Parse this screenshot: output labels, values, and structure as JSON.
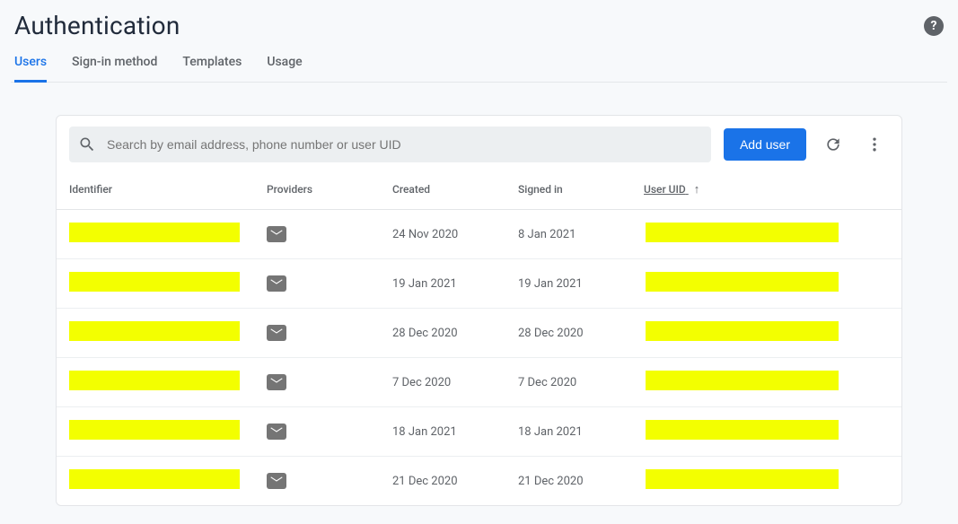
{
  "page": {
    "title": "Authentication"
  },
  "tabs": [
    {
      "label": "Users",
      "active": true
    },
    {
      "label": "Sign-in method",
      "active": false
    },
    {
      "label": "Templates",
      "active": false
    },
    {
      "label": "Usage",
      "active": false
    }
  ],
  "toolbar": {
    "search_placeholder": "Search by email address, phone number or user UID",
    "add_user_label": "Add user"
  },
  "columns": {
    "identifier": "Identifier",
    "providers": "Providers",
    "created": "Created",
    "signed_in": "Signed in",
    "user_uid": "User UID"
  },
  "sort": {
    "column": "user_uid",
    "direction": "asc"
  },
  "rows": [
    {
      "identifier_redacted": true,
      "provider": "email",
      "created": "24 Nov 2020",
      "signed_in": "8 Jan 2021",
      "uid_redacted": true
    },
    {
      "identifier_redacted": true,
      "provider": "email",
      "created": "19 Jan 2021",
      "signed_in": "19 Jan 2021",
      "uid_redacted": true
    },
    {
      "identifier_redacted": true,
      "provider": "email",
      "created": "28 Dec 2020",
      "signed_in": "28 Dec 2020",
      "uid_redacted": true
    },
    {
      "identifier_redacted": true,
      "provider": "email",
      "created": "7 Dec 2020",
      "signed_in": "7 Dec 2020",
      "uid_redacted": true
    },
    {
      "identifier_redacted": true,
      "provider": "email",
      "created": "18 Jan 2021",
      "signed_in": "18 Jan 2021",
      "uid_redacted": true
    },
    {
      "identifier_redacted": true,
      "provider": "email",
      "created": "21 Dec 2020",
      "signed_in": "21 Dec 2020",
      "uid_redacted": true
    }
  ]
}
